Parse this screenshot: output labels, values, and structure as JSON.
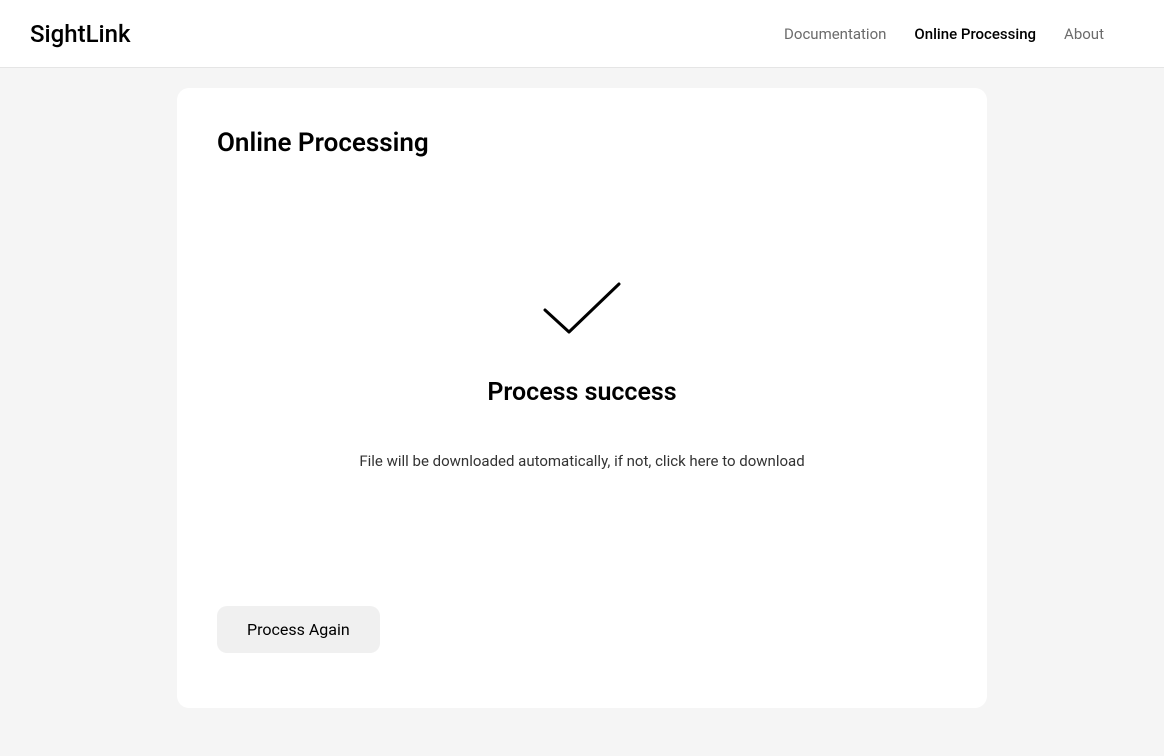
{
  "header": {
    "logo": "SightLink",
    "nav": [
      {
        "label": "Documentation",
        "active": false
      },
      {
        "label": "Online Processing",
        "active": true
      },
      {
        "label": "About",
        "active": false
      }
    ]
  },
  "card": {
    "title": "Online Processing",
    "success": {
      "icon": "checkmark-icon",
      "heading": "Process success",
      "message": "File will be downloaded automatically, if not, click here to download"
    },
    "button": {
      "process_again": "Process Again"
    }
  }
}
